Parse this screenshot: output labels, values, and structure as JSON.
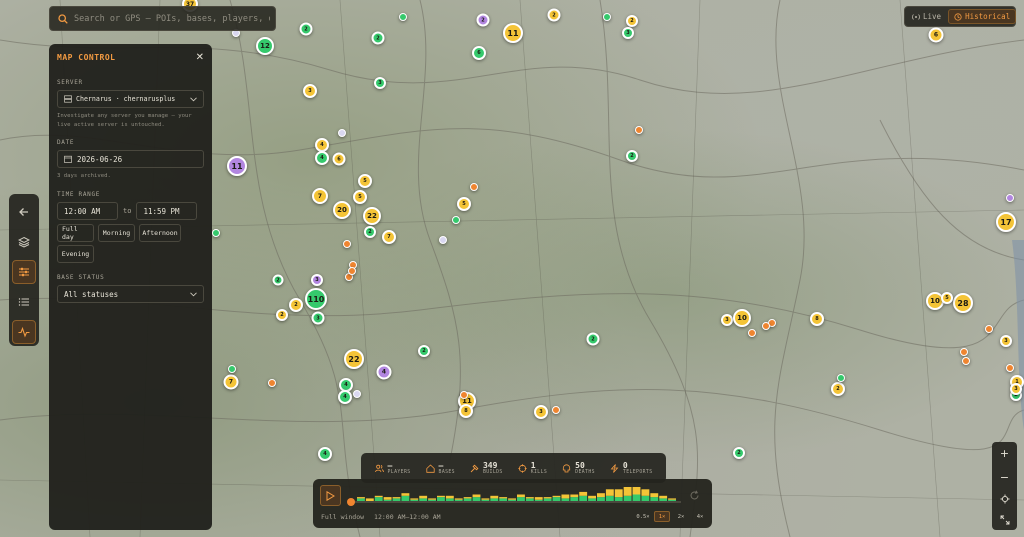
{
  "search": {
    "placeholder": "Search or GPS — POIs, bases, players, o"
  },
  "mode": {
    "live_label": "Live",
    "historical_label": "Historical",
    "active": "historical"
  },
  "panel": {
    "title": "MAP CONTROL",
    "server_label": "SERVER",
    "server_value": "Chernarus · chernarusplus",
    "server_hint": "Investigate any server you manage — your live active server is untouched.",
    "date_label": "DATE",
    "date_value": "2026-06-26",
    "date_hint": "3 days archived.",
    "time_label": "TIME RANGE",
    "time_from": "12:00 AM",
    "time_to_word": "to",
    "time_to": "11:59 PM",
    "presets": [
      "Full day",
      "Morning",
      "Afternoon",
      "Evening"
    ],
    "base_status_label": "BASE STATUS",
    "base_status_value": "All statuses"
  },
  "stats": [
    {
      "icon": "players-icon",
      "value": "—",
      "label": "PLAYERS"
    },
    {
      "icon": "bases-icon",
      "value": "—",
      "label": "BASES"
    },
    {
      "icon": "builds-icon",
      "value": "349",
      "label": "BUILDS"
    },
    {
      "icon": "kills-icon",
      "value": "1",
      "label": "KILLS"
    },
    {
      "icon": "deaths-icon",
      "value": "50",
      "label": "DEATHS"
    },
    {
      "icon": "teleports-icon",
      "value": "0",
      "label": "TELEPORTS"
    }
  ],
  "timeline": {
    "window_label": "Full window",
    "window_range": "12:00 AM–12:00 AM",
    "speeds": [
      "0.5×",
      "1×",
      "2×",
      "4×"
    ],
    "active_speed": "1×"
  },
  "colors": {
    "accent": "#f29a42",
    "yellow": "#f4c437",
    "green": "#35c96c",
    "purple": "#b286e0",
    "orange": "#ef8530"
  },
  "markers": [
    {
      "t": "yellow",
      "n": "37"
    },
    {
      "t": "green",
      "n": "12"
    },
    {
      "t": "green",
      "n": "2"
    },
    {
      "t": "green",
      "n": "2"
    },
    {
      "t": "purple",
      "n": "2"
    },
    {
      "t": "yellow",
      "n": "11"
    },
    {
      "t": "yellow",
      "n": "2"
    },
    {
      "t": "yellow",
      "n": "2"
    },
    {
      "t": "green",
      "n": "3"
    },
    {
      "t": "yellow",
      "n": "6"
    },
    {
      "t": "green",
      "n": "6"
    },
    {
      "t": "green",
      "n": "3"
    },
    {
      "t": "yellow",
      "n": "3"
    },
    {
      "t": "purple",
      "n": "11"
    },
    {
      "t": "yellow",
      "n": "4"
    },
    {
      "t": "green",
      "n": "4"
    },
    {
      "t": "yellow",
      "n": "6"
    },
    {
      "t": "green",
      "n": "2"
    },
    {
      "t": "yellow",
      "n": "5"
    },
    {
      "t": "yellow",
      "n": "7"
    },
    {
      "t": "yellow",
      "n": "20"
    },
    {
      "t": "yellow",
      "n": "5"
    },
    {
      "t": "yellow",
      "n": "22"
    },
    {
      "t": "green",
      "n": "2"
    },
    {
      "t": "yellow",
      "n": "7"
    },
    {
      "t": "yellow",
      "n": "5"
    },
    {
      "t": "purple",
      "n": "3"
    },
    {
      "t": "green",
      "n": "2"
    },
    {
      "t": "green",
      "n": "110"
    },
    {
      "t": "yellow",
      "n": "2"
    },
    {
      "t": "yellow",
      "n": "2"
    },
    {
      "t": "green",
      "n": "3"
    },
    {
      "t": "yellow",
      "n": "22"
    },
    {
      "t": "purple",
      "n": "4"
    },
    {
      "t": "green",
      "n": "2"
    },
    {
      "t": "yellow",
      "n": "7"
    },
    {
      "t": "green",
      "n": "4"
    },
    {
      "t": "green",
      "n": "4"
    },
    {
      "t": "green",
      "n": "4"
    },
    {
      "t": "yellow",
      "n": "11"
    },
    {
      "t": "yellow",
      "n": "8"
    },
    {
      "t": "yellow",
      "n": "3"
    },
    {
      "t": "yellow",
      "n": "3"
    },
    {
      "t": "yellow",
      "n": "10"
    },
    {
      "t": "yellow",
      "n": "8"
    },
    {
      "t": "yellow",
      "n": "10"
    },
    {
      "t": "yellow",
      "n": "28"
    },
    {
      "t": "yellow",
      "n": "17"
    },
    {
      "t": "yellow",
      "n": "3"
    },
    {
      "t": "yellow",
      "n": "2"
    },
    {
      "t": "green",
      "n": "2"
    },
    {
      "t": "yellow",
      "n": "1"
    },
    {
      "t": "green",
      "n": "2"
    },
    {
      "t": "green",
      "n": "2"
    },
    {
      "t": "yellow",
      "n": "3"
    },
    {
      "t": "yellow",
      "n": "5"
    }
  ],
  "histogram": [
    {
      "g": 2,
      "y": 1
    },
    {
      "g": 0,
      "y": 2
    },
    {
      "g": 3,
      "y": 1
    },
    {
      "g": 1,
      "y": 2
    },
    {
      "g": 2,
      "y": 1
    },
    {
      "g": 4,
      "y": 2
    },
    {
      "g": 1,
      "y": 1
    },
    {
      "g": 2,
      "y": 2
    },
    {
      "g": 1,
      "y": 1
    },
    {
      "g": 3,
      "y": 1
    },
    {
      "g": 2,
      "y": 2
    },
    {
      "g": 1,
      "y": 1
    },
    {
      "g": 2,
      "y": 1
    },
    {
      "g": 3,
      "y": 2
    },
    {
      "g": 1,
      "y": 1
    },
    {
      "g": 2,
      "y": 2
    },
    {
      "g": 2,
      "y": 1
    },
    {
      "g": 1,
      "y": 1
    },
    {
      "g": 3,
      "y": 2
    },
    {
      "g": 2,
      "y": 1
    },
    {
      "g": 1,
      "y": 2
    },
    {
      "g": 2,
      "y": 1
    },
    {
      "g": 3,
      "y": 1
    },
    {
      "g": 2,
      "y": 3
    },
    {
      "g": 3,
      "y": 2
    },
    {
      "g": 4,
      "y": 3
    },
    {
      "g": 2,
      "y": 2
    },
    {
      "g": 3,
      "y": 3
    },
    {
      "g": 4,
      "y": 5
    },
    {
      "g": 3,
      "y": 6
    },
    {
      "g": 4,
      "y": 7
    },
    {
      "g": 5,
      "y": 6
    },
    {
      "g": 4,
      "y": 5
    },
    {
      "g": 3,
      "y": 3
    },
    {
      "g": 2,
      "y": 2
    },
    {
      "g": 1,
      "y": 1
    }
  ]
}
